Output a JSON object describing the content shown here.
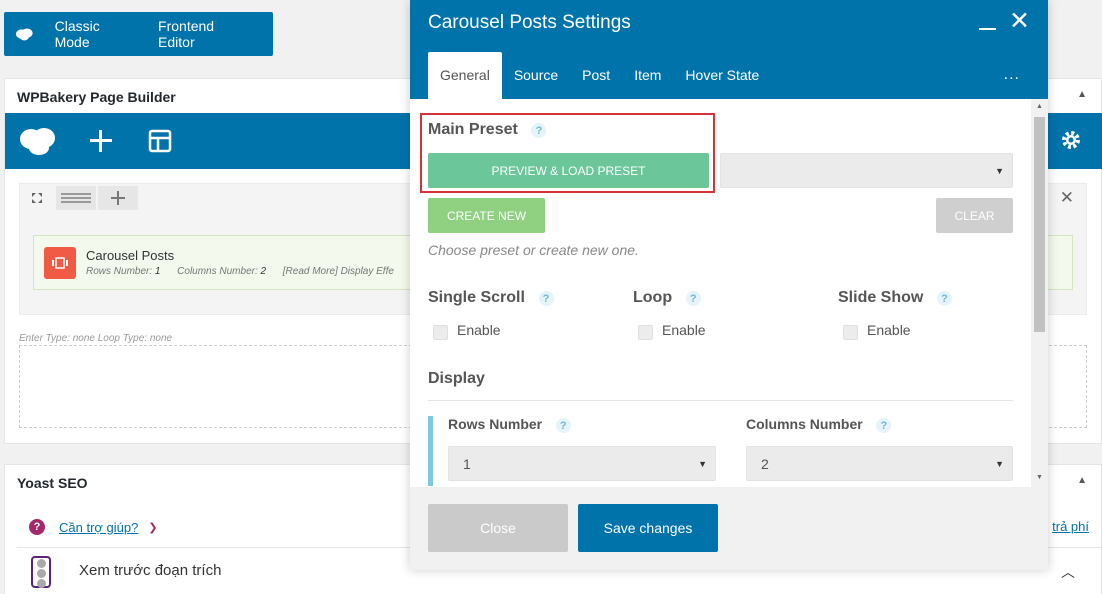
{
  "mode_bar": {
    "classic_label": "Classic Mode",
    "frontend_label": "Frontend Editor"
  },
  "wpbakery": {
    "title": "WPBakery Page Builder",
    "element": {
      "title": "Carousel Posts",
      "rows_label": "Rows Number:",
      "rows_value": "1",
      "cols_label": "Columns Number:",
      "cols_value": "2",
      "extra": "[Read More] Display Effe"
    },
    "enter_note": "Enter Type: none  Loop Type: none"
  },
  "yoast": {
    "title": "Yoast SEO",
    "help_link": "Cần trợ giúp?",
    "right_link": "trả phí",
    "preview_label": "Xem trước đoạn trích"
  },
  "modal": {
    "title": "Carousel Posts Settings",
    "tabs": [
      "General",
      "Source",
      "Post",
      "Item",
      "Hover State"
    ],
    "more": "...",
    "main_preset_label": "Main Preset",
    "preview_button": "PREVIEW & LOAD PRESET",
    "preset_select_value": "",
    "create_new_button": "CREATE NEW",
    "clear_button": "CLEAR",
    "hint": "Choose preset or create new one.",
    "toggles": [
      {
        "label": "Single Scroll",
        "checkbox_label": "Enable"
      },
      {
        "label": "Loop",
        "checkbox_label": "Enable"
      },
      {
        "label": "Slide Show",
        "checkbox_label": "Enable"
      }
    ],
    "display_label": "Display",
    "rows_number_label": "Rows Number",
    "rows_number_value": "1",
    "columns_number_label": "Columns Number",
    "columns_number_value": "2",
    "help_glyph": "?",
    "close_button": "Close",
    "save_button": "Save changes"
  }
}
